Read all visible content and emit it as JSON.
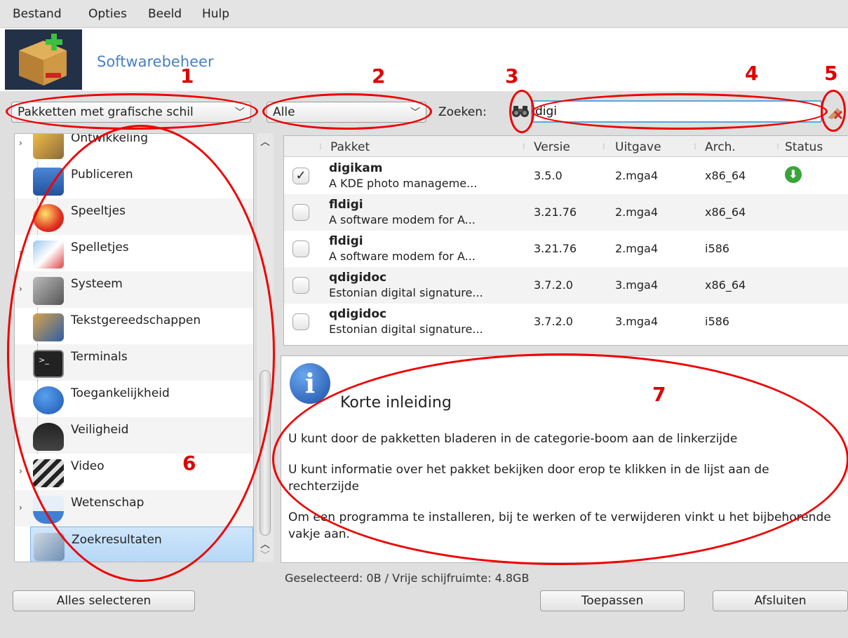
{
  "menu": [
    "Bestand",
    "Opties",
    "Beeld",
    "Hulp"
  ],
  "app_title": "Softwarebeheer",
  "annotations": [
    "1",
    "2",
    "3",
    "4",
    "5",
    "6",
    "7"
  ],
  "filters": {
    "package_type": "Pakketten met grafische schil",
    "status": "Alle",
    "search_label": "Zoeken:",
    "search_value": "digi"
  },
  "categories": [
    {
      "label": "Ontwikkeling",
      "expandable": true,
      "icon": "tools-icon"
    },
    {
      "label": "Publiceren",
      "expandable": false,
      "icon": "book-icon"
    },
    {
      "label": "Speeltjes",
      "expandable": false,
      "icon": "ball-icon"
    },
    {
      "label": "Spelletjes",
      "expandable": true,
      "icon": "cards-icon"
    },
    {
      "label": "Systeem",
      "expandable": true,
      "icon": "wrench-screwdriver-icon"
    },
    {
      "label": "Tekstgereedschappen",
      "expandable": false,
      "icon": "globe-book-icon"
    },
    {
      "label": "Terminals",
      "expandable": false,
      "icon": "terminal-icon"
    },
    {
      "label": "Toegankelijkheid",
      "expandable": false,
      "icon": "accessibility-icon"
    },
    {
      "label": "Veiligheid",
      "expandable": false,
      "icon": "police-icon"
    },
    {
      "label": "Video",
      "expandable": true,
      "icon": "clapperboard-icon"
    },
    {
      "label": "Wetenschap",
      "expandable": true,
      "icon": "flask-icon"
    },
    {
      "label": "Zoekresultaten",
      "expandable": false,
      "icon": "search-results-icon",
      "selected": true
    }
  ],
  "table": {
    "headers": [
      "Pakket",
      "Versie",
      "Uitgave",
      "Arch.",
      "Status"
    ],
    "rows": [
      {
        "name": "digikam",
        "desc": "A KDE photo manageme...",
        "version": "3.5.0",
        "release": "2.mga4",
        "arch": "x86_64",
        "checked": true,
        "status": "installed-icon"
      },
      {
        "name": "fldigi",
        "desc": "A software modem for A...",
        "version": "3.21.76",
        "release": "2.mga4",
        "arch": "x86_64",
        "checked": false
      },
      {
        "name": "fldigi",
        "desc": "A software modem for A...",
        "version": "3.21.76",
        "release": "2.mga4",
        "arch": "i586",
        "checked": false
      },
      {
        "name": "qdigidoc",
        "desc": "Estonian digital signature...",
        "version": "3.7.2.0",
        "release": "3.mga4",
        "arch": "x86_64",
        "checked": false
      },
      {
        "name": "qdigidoc",
        "desc": "Estonian digital signature...",
        "version": "3.7.2.0",
        "release": "3.mga4",
        "arch": "i586",
        "checked": false
      }
    ]
  },
  "info": {
    "title": "Korte inleiding",
    "p1": "U kunt door de pakketten bladeren in de categorie-boom aan de linkerzijde",
    "p2": "U kunt informatie over het pakket bekijken door erop te klikken in de lijst aan de rechterzijde",
    "p3": "Om een programma te installeren, bij te werken of te verwijderen vinkt u het bijbehorende vakje aan."
  },
  "status_text": "Geselecteerd: 0B / Vrije schijfruimte: 4.8GB",
  "buttons": {
    "select_all": "Alles selecteren",
    "apply": "Toepassen",
    "quit": "Afsluiten"
  }
}
